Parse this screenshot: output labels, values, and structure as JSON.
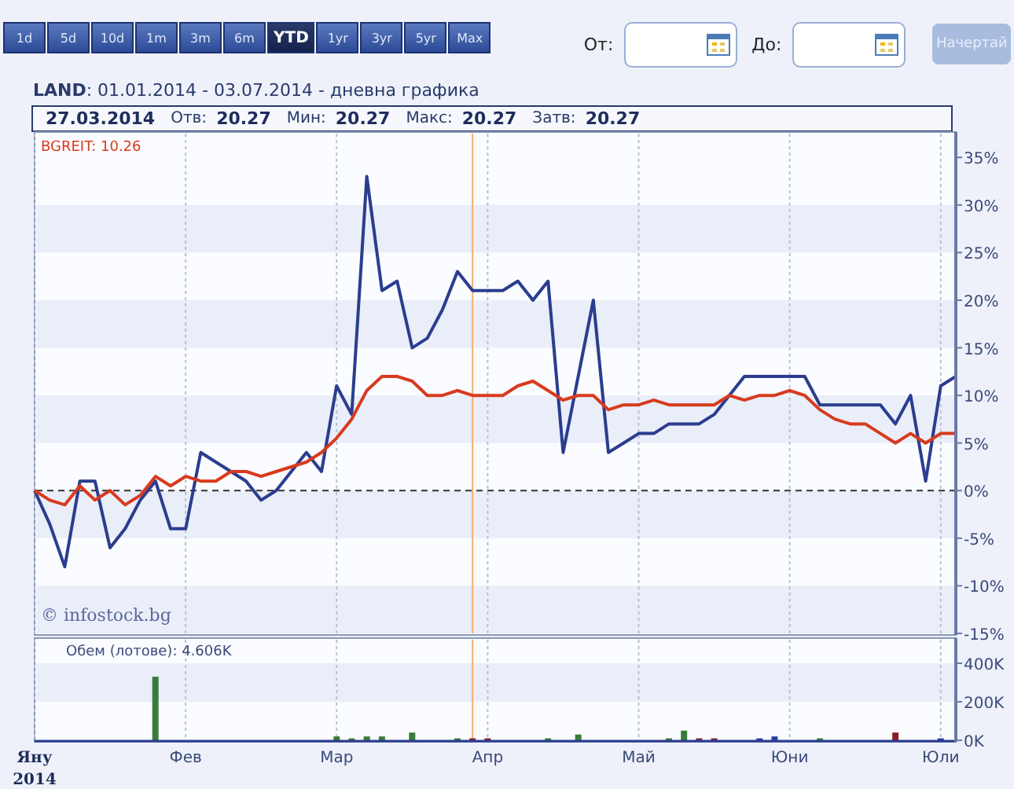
{
  "range_buttons": [
    {
      "label": "1d",
      "selected": false
    },
    {
      "label": "5d",
      "selected": false
    },
    {
      "label": "10d",
      "selected": false
    },
    {
      "label": "1m",
      "selected": false
    },
    {
      "label": "3m",
      "selected": false
    },
    {
      "label": "6m",
      "selected": false
    },
    {
      "label": "YTD",
      "selected": true
    },
    {
      "label": "1yr",
      "selected": false
    },
    {
      "label": "3yr",
      "selected": false
    },
    {
      "label": "5yr",
      "selected": false
    },
    {
      "label": "Max",
      "selected": false
    }
  ],
  "from_field": {
    "label": "От:"
  },
  "to_field": {
    "label": "До:"
  },
  "draw_button": {
    "label": "Начертай",
    "disabled": true
  },
  "title": "**LAND**: 01.01.2014 - 03.07.2014 - дневна графика",
  "info_bar": {
    "date": "27.03.2014",
    "items": [
      {
        "label": "Отв:",
        "value": "20.27"
      },
      {
        "label": "Мин:",
        "value": "20.27"
      },
      {
        "label": "Макс:",
        "value": "20.27"
      },
      {
        "label": "Затв:",
        "value": "20.27"
      }
    ]
  },
  "legend": "BGREIT: 10.26",
  "credit": "© infostock.bg",
  "price_chart": {
    "chart_data": {
      "type": "line",
      "ylim": [
        -15,
        37.5
      ],
      "grid": true,
      "yticks": [
        {
          "value": 35,
          "label": "35%"
        },
        {
          "value": 30,
          "label": "30%"
        },
        {
          "value": 25,
          "label": "25%"
        },
        {
          "value": 20,
          "label": "20%"
        },
        {
          "value": 15,
          "label": "15%"
        },
        {
          "value": 10,
          "label": "10%"
        },
        {
          "value": 5,
          "label": "5%"
        },
        {
          "value": 0,
          "label": "0%"
        },
        {
          "value": -5,
          "label": "-5%"
        },
        {
          "value": -10,
          "label": "-10%"
        },
        {
          "value": -15,
          "label": "-15%"
        }
      ],
      "ref_lines": [
        {
          "axis": "y",
          "value": 0
        }
      ],
      "series": [
        {
          "color": "#2b3d8f",
          "values": [
            0,
            -3.5,
            -8,
            1,
            1,
            -6,
            -4,
            -1,
            1,
            -4,
            -4,
            4,
            3,
            2,
            1,
            -1,
            0,
            2,
            4,
            2,
            11,
            8,
            33,
            21,
            22,
            15,
            16,
            19,
            23,
            21,
            21,
            21,
            22,
            20,
            22,
            4,
            12,
            20,
            4,
            5,
            6,
            6,
            7,
            7,
            7,
            8,
            10,
            12,
            12,
            12,
            12,
            12,
            9,
            9,
            9,
            9,
            9,
            7,
            10,
            1,
            11,
            12
          ]
        },
        {
          "color": "#d83a1e",
          "values": [
            0,
            -1,
            -1.5,
            0.5,
            -1,
            0,
            -1.5,
            -0.5,
            1.5,
            0.5,
            1.5,
            1,
            1,
            2,
            2,
            1.5,
            2,
            2.5,
            3,
            4,
            5.5,
            7.5,
            10.5,
            12,
            12,
            11.5,
            10,
            10,
            10.5,
            10,
            10,
            10,
            11,
            11.5,
            10.5,
            9.5,
            10,
            10,
            8.5,
            9,
            9,
            9.5,
            9,
            9,
            9,
            9,
            10,
            9.5,
            10,
            10,
            10.5,
            10,
            8.5,
            7.5,
            7,
            7,
            6,
            5,
            6,
            5,
            6,
            6
          ]
        }
      ]
    }
  },
  "volume_chart": {
    "title": "Обем (лотове): 4.606K",
    "chart_data": {
      "type": "bar",
      "ylim": [
        0,
        400
      ],
      "grid": true,
      "bands": [
        {
          "axis": "y",
          "from": 200,
          "to": 400
        }
      ],
      "yticks": [
        {
          "value": 400,
          "label": "400K"
        },
        {
          "value": 200,
          "label": "200K"
        },
        {
          "value": 0,
          "label": "0K"
        }
      ],
      "categories": [
        "Яну",
        null,
        null,
        null,
        null,
        null,
        null,
        null,
        null,
        null,
        "Фев",
        null,
        null,
        null,
        null,
        null,
        null,
        null,
        null,
        null,
        "Мар",
        null,
        null,
        null,
        null,
        null,
        null,
        null,
        null,
        null,
        "Апр",
        null,
        null,
        null,
        null,
        null,
        null,
        null,
        null,
        null,
        "Май",
        null,
        null,
        null,
        null,
        null,
        null,
        null,
        null,
        null,
        "Юни",
        null,
        null,
        null,
        null,
        null,
        null,
        null,
        null,
        null,
        "Юли",
        null
      ],
      "series": [
        {
          "color": "#3a7a3a",
          "values": [
            null,
            null,
            null,
            null,
            null,
            null,
            null,
            null,
            330,
            null,
            null,
            null,
            null,
            null,
            null,
            null,
            null,
            null,
            null,
            null,
            20,
            10,
            20,
            20,
            null,
            40,
            null,
            null,
            10,
            null,
            null,
            null,
            null,
            null,
            10,
            null,
            30,
            null,
            null,
            null,
            null,
            null,
            10,
            50,
            null,
            null,
            null,
            null,
            null,
            null,
            null,
            null,
            10,
            null,
            null,
            null,
            null,
            null,
            null,
            null,
            null,
            null
          ]
        },
        {
          "color": "#8a1a2a",
          "values": [
            null,
            null,
            null,
            null,
            null,
            null,
            null,
            null,
            null,
            null,
            null,
            null,
            null,
            null,
            null,
            null,
            null,
            null,
            null,
            null,
            null,
            null,
            null,
            null,
            null,
            null,
            null,
            null,
            null,
            10,
            10,
            null,
            null,
            null,
            null,
            null,
            null,
            null,
            null,
            null,
            null,
            null,
            null,
            null,
            10,
            10,
            null,
            null,
            null,
            null,
            null,
            null,
            null,
            null,
            null,
            null,
            null,
            40,
            null,
            null,
            null,
            null
          ]
        },
        {
          "color": "#2b3d9f",
          "values": [
            null,
            null,
            null,
            null,
            null,
            null,
            null,
            null,
            null,
            null,
            null,
            null,
            null,
            null,
            null,
            null,
            null,
            null,
            null,
            null,
            null,
            null,
            null,
            null,
            null,
            null,
            null,
            null,
            null,
            null,
            null,
            null,
            null,
            null,
            null,
            null,
            null,
            null,
            null,
            null,
            null,
            null,
            null,
            null,
            null,
            null,
            null,
            null,
            10,
            20,
            null,
            null,
            null,
            null,
            null,
            null,
            null,
            null,
            null,
            null,
            10,
            null
          ]
        }
      ]
    }
  },
  "year_label": "2014"
}
